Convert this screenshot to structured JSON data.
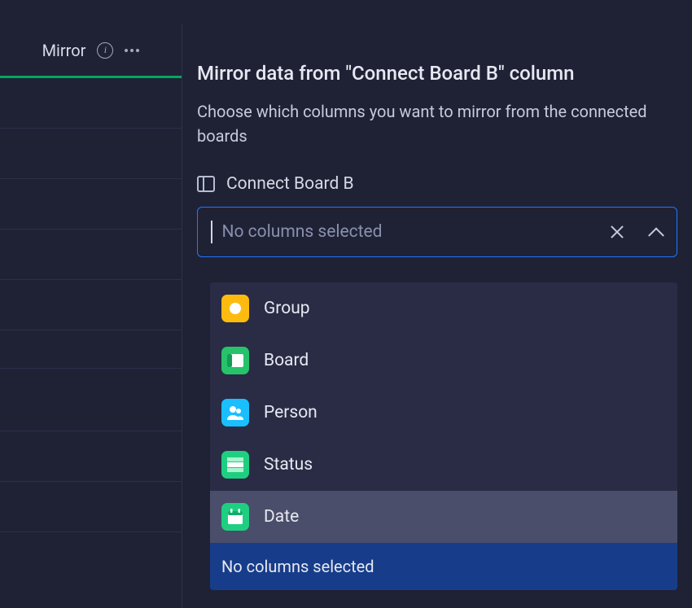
{
  "column_header": {
    "title": "Mirror",
    "info_icon": "info-icon",
    "menu_icon": "kebab-icon"
  },
  "panel": {
    "heading": "Mirror data from \"Connect Board B\" column",
    "subtitle": "Choose which columns you want to mirror from the connected boards",
    "source_board": {
      "icon": "board-outline-icon",
      "name": "Connect Board B"
    },
    "select": {
      "placeholder": "No columns selected",
      "value": "",
      "clear_icon": "close-icon",
      "toggle_icon": "chevron-up-icon",
      "open": true
    },
    "dropdown": {
      "options": [
        {
          "icon": "group-type-icon",
          "tile_color": "#fdbb10",
          "label": "Group"
        },
        {
          "icon": "board-type-icon",
          "tile_color": "#27c36a",
          "label": "Board"
        },
        {
          "icon": "person-type-icon",
          "tile_color": "#1abfff",
          "label": "Person"
        },
        {
          "icon": "status-type-icon",
          "tile_color": "#1fcf81",
          "label": "Status"
        },
        {
          "icon": "date-type-icon",
          "tile_color": "#1fcf81",
          "label": "Date",
          "hovered": true
        }
      ],
      "footer_text": "No columns selected"
    }
  },
  "colors": {
    "accent_green": "#00a762",
    "focus_border": "#1f76ff",
    "footer_bg": "#173d8a"
  }
}
